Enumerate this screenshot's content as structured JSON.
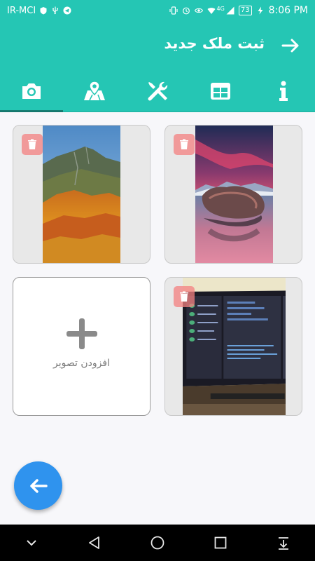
{
  "status_bar": {
    "carrier": "IR-MCI",
    "battery": "73",
    "time": "8:06 PM",
    "network": "4G"
  },
  "app_bar": {
    "title": "ثبت ملک جدید"
  },
  "tabs": [
    {
      "icon": "info-icon",
      "active": false
    },
    {
      "icon": "table-icon",
      "active": false
    },
    {
      "icon": "tools-icon",
      "active": false
    },
    {
      "icon": "map-icon",
      "active": false
    },
    {
      "icon": "camera-icon",
      "active": true
    }
  ],
  "photos": [
    {
      "icon": "trash-icon",
      "subject": "autumn mountain"
    },
    {
      "icon": "trash-icon",
      "subject": "lake rock sunset"
    },
    {
      "icon": "trash-icon",
      "subject": "monitor screen"
    }
  ],
  "add_photo": {
    "label": "افزودن تصویر"
  },
  "colors": {
    "primary": "#25c6b4",
    "fab": "#2f93ee",
    "delete": "#f48080"
  }
}
